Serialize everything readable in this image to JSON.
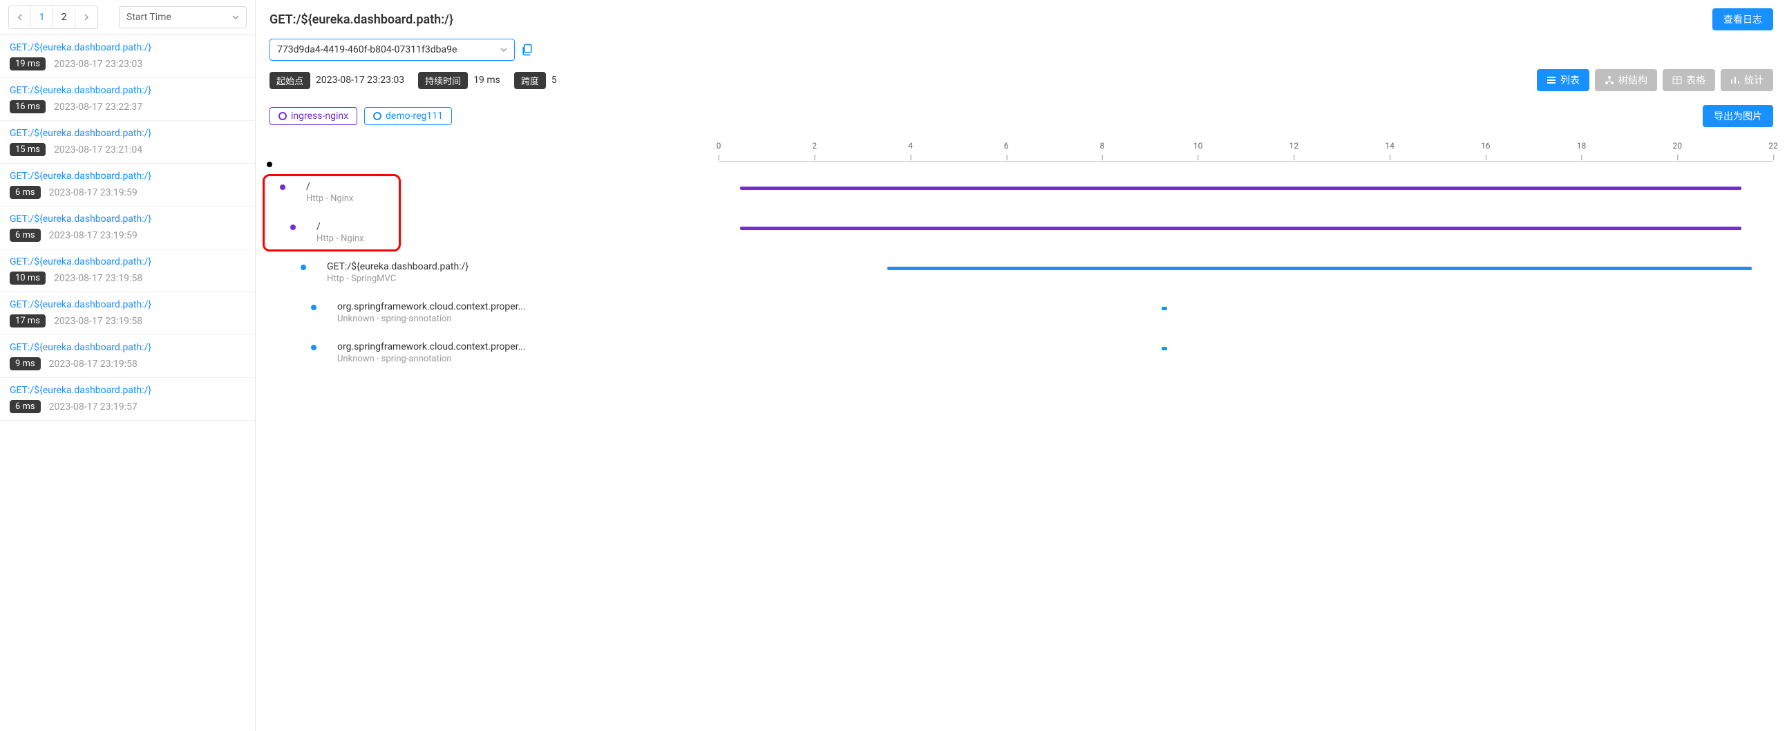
{
  "pagination": {
    "pages": [
      "1",
      "2"
    ],
    "active_page": 0,
    "sort_label": "Start Time"
  },
  "trace_list": [
    {
      "path": "GET:/${eureka.dashboard.path:/}",
      "duration": "19 ms",
      "time": "2023-08-17 23:23:03"
    },
    {
      "path": "GET:/${eureka.dashboard.path:/}",
      "duration": "16 ms",
      "time": "2023-08-17 23:22:37"
    },
    {
      "path": "GET:/${eureka.dashboard.path:/}",
      "duration": "15 ms",
      "time": "2023-08-17 23:21:04"
    },
    {
      "path": "GET:/${eureka.dashboard.path:/}",
      "duration": "6 ms",
      "time": "2023-08-17 23:19:59"
    },
    {
      "path": "GET:/${eureka.dashboard.path:/}",
      "duration": "6 ms",
      "time": "2023-08-17 23:19:59"
    },
    {
      "path": "GET:/${eureka.dashboard.path:/}",
      "duration": "10 ms",
      "time": "2023-08-17 23:19:58"
    },
    {
      "path": "GET:/${eureka.dashboard.path:/}",
      "duration": "17 ms",
      "time": "2023-08-17 23:19:58"
    },
    {
      "path": "GET:/${eureka.dashboard.path:/}",
      "duration": "9 ms",
      "time": "2023-08-17 23:19:58"
    },
    {
      "path": "GET:/${eureka.dashboard.path:/}",
      "duration": "6 ms",
      "time": "2023-08-17 23:19:57"
    }
  ],
  "main": {
    "title": "GET:/${eureka.dashboard.path:/}",
    "log_button": "查看日志",
    "trace_id": "773d9da4-4419-460f-b804-07311f3dba9e",
    "info": {
      "start_label": "起始点",
      "start_value": "2023-08-17 23:23:03",
      "duration_label": "持续时间",
      "duration_value": "19 ms",
      "span_label": "跨度",
      "span_value": "5"
    },
    "view_buttons": {
      "list": "列表",
      "tree": "树结构",
      "table": "表格",
      "stats": "统计"
    },
    "filters": {
      "ingress": "ingress-nginx",
      "demo": "demo-reg111"
    },
    "export_button": "导出为图片"
  },
  "timeline": {
    "ticks": [
      "0",
      "2",
      "4",
      "6",
      "8",
      "10",
      "12",
      "14",
      "16",
      "18",
      "20",
      "22"
    ],
    "spans": [
      {
        "title": "/",
        "sub": "Http - Nginx",
        "color": "purple",
        "indent": 15,
        "start": 2,
        "width": 95
      },
      {
        "title": "/",
        "sub": "Http - Nginx",
        "color": "purple",
        "indent": 30,
        "start": 2,
        "width": 95
      },
      {
        "title": "GET:/${eureka.dashboard.path:/}",
        "sub": "Http - SpringMVC",
        "color": "blue",
        "indent": 45,
        "start": 16,
        "width": 82
      },
      {
        "title": "org.springframework.cloud.context.proper...",
        "sub": "Unknown - spring-annotation",
        "color": "blue",
        "indent": 60,
        "start": 42,
        "width": 0.5
      },
      {
        "title": "org.springframework.cloud.context.proper...",
        "sub": "Unknown - spring-annotation",
        "color": "blue",
        "indent": 60,
        "start": 42,
        "width": 0.5
      }
    ]
  }
}
